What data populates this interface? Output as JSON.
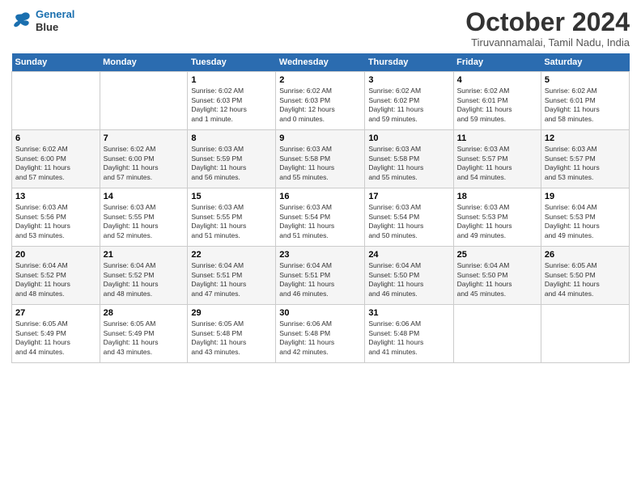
{
  "logo": {
    "line1": "General",
    "line2": "Blue"
  },
  "title": "October 2024",
  "location": "Tiruvannamalai, Tamil Nadu, India",
  "days_header": [
    "Sunday",
    "Monday",
    "Tuesday",
    "Wednesday",
    "Thursday",
    "Friday",
    "Saturday"
  ],
  "weeks": [
    [
      {
        "num": "",
        "info": ""
      },
      {
        "num": "",
        "info": ""
      },
      {
        "num": "1",
        "info": "Sunrise: 6:02 AM\nSunset: 6:03 PM\nDaylight: 12 hours\nand 1 minute."
      },
      {
        "num": "2",
        "info": "Sunrise: 6:02 AM\nSunset: 6:03 PM\nDaylight: 12 hours\nand 0 minutes."
      },
      {
        "num": "3",
        "info": "Sunrise: 6:02 AM\nSunset: 6:02 PM\nDaylight: 11 hours\nand 59 minutes."
      },
      {
        "num": "4",
        "info": "Sunrise: 6:02 AM\nSunset: 6:01 PM\nDaylight: 11 hours\nand 59 minutes."
      },
      {
        "num": "5",
        "info": "Sunrise: 6:02 AM\nSunset: 6:01 PM\nDaylight: 11 hours\nand 58 minutes."
      }
    ],
    [
      {
        "num": "6",
        "info": "Sunrise: 6:02 AM\nSunset: 6:00 PM\nDaylight: 11 hours\nand 57 minutes."
      },
      {
        "num": "7",
        "info": "Sunrise: 6:02 AM\nSunset: 6:00 PM\nDaylight: 11 hours\nand 57 minutes."
      },
      {
        "num": "8",
        "info": "Sunrise: 6:03 AM\nSunset: 5:59 PM\nDaylight: 11 hours\nand 56 minutes."
      },
      {
        "num": "9",
        "info": "Sunrise: 6:03 AM\nSunset: 5:58 PM\nDaylight: 11 hours\nand 55 minutes."
      },
      {
        "num": "10",
        "info": "Sunrise: 6:03 AM\nSunset: 5:58 PM\nDaylight: 11 hours\nand 55 minutes."
      },
      {
        "num": "11",
        "info": "Sunrise: 6:03 AM\nSunset: 5:57 PM\nDaylight: 11 hours\nand 54 minutes."
      },
      {
        "num": "12",
        "info": "Sunrise: 6:03 AM\nSunset: 5:57 PM\nDaylight: 11 hours\nand 53 minutes."
      }
    ],
    [
      {
        "num": "13",
        "info": "Sunrise: 6:03 AM\nSunset: 5:56 PM\nDaylight: 11 hours\nand 53 minutes."
      },
      {
        "num": "14",
        "info": "Sunrise: 6:03 AM\nSunset: 5:55 PM\nDaylight: 11 hours\nand 52 minutes."
      },
      {
        "num": "15",
        "info": "Sunrise: 6:03 AM\nSunset: 5:55 PM\nDaylight: 11 hours\nand 51 minutes."
      },
      {
        "num": "16",
        "info": "Sunrise: 6:03 AM\nSunset: 5:54 PM\nDaylight: 11 hours\nand 51 minutes."
      },
      {
        "num": "17",
        "info": "Sunrise: 6:03 AM\nSunset: 5:54 PM\nDaylight: 11 hours\nand 50 minutes."
      },
      {
        "num": "18",
        "info": "Sunrise: 6:03 AM\nSunset: 5:53 PM\nDaylight: 11 hours\nand 49 minutes."
      },
      {
        "num": "19",
        "info": "Sunrise: 6:04 AM\nSunset: 5:53 PM\nDaylight: 11 hours\nand 49 minutes."
      }
    ],
    [
      {
        "num": "20",
        "info": "Sunrise: 6:04 AM\nSunset: 5:52 PM\nDaylight: 11 hours\nand 48 minutes."
      },
      {
        "num": "21",
        "info": "Sunrise: 6:04 AM\nSunset: 5:52 PM\nDaylight: 11 hours\nand 48 minutes."
      },
      {
        "num": "22",
        "info": "Sunrise: 6:04 AM\nSunset: 5:51 PM\nDaylight: 11 hours\nand 47 minutes."
      },
      {
        "num": "23",
        "info": "Sunrise: 6:04 AM\nSunset: 5:51 PM\nDaylight: 11 hours\nand 46 minutes."
      },
      {
        "num": "24",
        "info": "Sunrise: 6:04 AM\nSunset: 5:50 PM\nDaylight: 11 hours\nand 46 minutes."
      },
      {
        "num": "25",
        "info": "Sunrise: 6:04 AM\nSunset: 5:50 PM\nDaylight: 11 hours\nand 45 minutes."
      },
      {
        "num": "26",
        "info": "Sunrise: 6:05 AM\nSunset: 5:50 PM\nDaylight: 11 hours\nand 44 minutes."
      }
    ],
    [
      {
        "num": "27",
        "info": "Sunrise: 6:05 AM\nSunset: 5:49 PM\nDaylight: 11 hours\nand 44 minutes."
      },
      {
        "num": "28",
        "info": "Sunrise: 6:05 AM\nSunset: 5:49 PM\nDaylight: 11 hours\nand 43 minutes."
      },
      {
        "num": "29",
        "info": "Sunrise: 6:05 AM\nSunset: 5:48 PM\nDaylight: 11 hours\nand 43 minutes."
      },
      {
        "num": "30",
        "info": "Sunrise: 6:06 AM\nSunset: 5:48 PM\nDaylight: 11 hours\nand 42 minutes."
      },
      {
        "num": "31",
        "info": "Sunrise: 6:06 AM\nSunset: 5:48 PM\nDaylight: 11 hours\nand 41 minutes."
      },
      {
        "num": "",
        "info": ""
      },
      {
        "num": "",
        "info": ""
      }
    ]
  ]
}
